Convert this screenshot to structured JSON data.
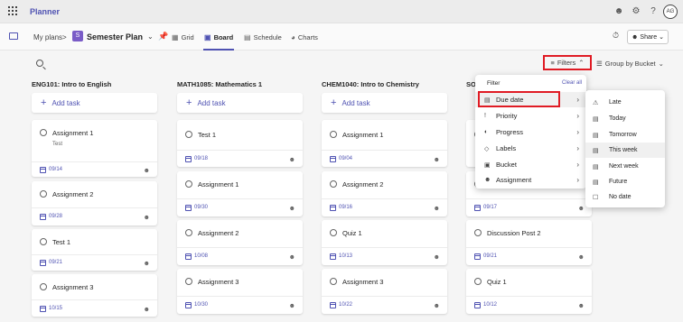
{
  "app": {
    "title": "Planner",
    "avatar_initials": "AG"
  },
  "nav": {
    "breadcrumb_root": "My plans",
    "breadcrumb_sep": ">",
    "plan_badge": "S",
    "plan_name": "Semester Plan",
    "tabs": [
      {
        "label": "Grid",
        "icon": "grid-icon"
      },
      {
        "label": "Board",
        "icon": "board-icon"
      },
      {
        "label": "Schedule",
        "icon": "schedule-icon"
      },
      {
        "label": "Charts",
        "icon": "charts-icon"
      }
    ],
    "share_label": "Share"
  },
  "toolbar": {
    "filters_label": "Filters",
    "groupby_label": "Group by Bucket"
  },
  "add_task_label": "Add task",
  "columns": [
    {
      "title": "ENG101: Intro to English",
      "cards": [
        {
          "title": "Assignment 1",
          "subtitle": "Test",
          "date": "09/14"
        },
        {
          "title": "Assignment 2",
          "date": "09/28"
        },
        {
          "title": "Test 1",
          "date": "09/21"
        },
        {
          "title": "Assignment 3",
          "date": "10/15"
        }
      ]
    },
    {
      "title": "MATH1085: Mathematics 1",
      "cards": [
        {
          "title": "Test 1",
          "date": "09/18"
        },
        {
          "title": "Assignment 1",
          "date": "09/30"
        },
        {
          "title": "Assignment 2",
          "date": "10/08"
        },
        {
          "title": "Assignment 3",
          "date": "10/30"
        }
      ]
    },
    {
      "title": "CHEM1040: Intro to Chemistry",
      "cards": [
        {
          "title": "Assignment 1",
          "date": "09/04"
        },
        {
          "title": "Assignment 2",
          "date": "09/16"
        },
        {
          "title": "Quiz 1",
          "date": "10/13"
        },
        {
          "title": "Assignment 3",
          "date": "10/22"
        }
      ]
    },
    {
      "title": "SO",
      "cards": [
        {
          "title": "",
          "date": ""
        },
        {
          "title": "",
          "date": "09/17"
        },
        {
          "title": "Discussion Post 2",
          "date": "09/21"
        },
        {
          "title": "Quiz 1",
          "date": "10/12"
        }
      ]
    }
  ],
  "filter_panel": {
    "title": "Filter",
    "clear_all": "Clear all",
    "items": [
      {
        "label": "Due date",
        "icon": "calendar-icon"
      },
      {
        "label": "Priority",
        "icon": "priority-icon"
      },
      {
        "label": "Progress",
        "icon": "progress-icon"
      },
      {
        "label": "Labels",
        "icon": "tag-icon"
      },
      {
        "label": "Bucket",
        "icon": "bucket-icon"
      },
      {
        "label": "Assignment",
        "icon": "people-icon"
      }
    ]
  },
  "due_date_options": [
    {
      "label": "Late",
      "icon": "warning-icon"
    },
    {
      "label": "Today",
      "icon": "calendar-today-icon"
    },
    {
      "label": "Tomorrow",
      "icon": "calendar-tomorrow-icon"
    },
    {
      "label": "This week",
      "icon": "calendar-week-icon"
    },
    {
      "label": "Next week",
      "icon": "calendar-next-week-icon"
    },
    {
      "label": "Future",
      "icon": "calendar-future-icon"
    },
    {
      "label": "No date",
      "icon": "calendar-empty-icon"
    }
  ],
  "colors": {
    "accent": "#4f52b2",
    "highlight": "#e01b24",
    "badge": "#7a5cc7"
  }
}
